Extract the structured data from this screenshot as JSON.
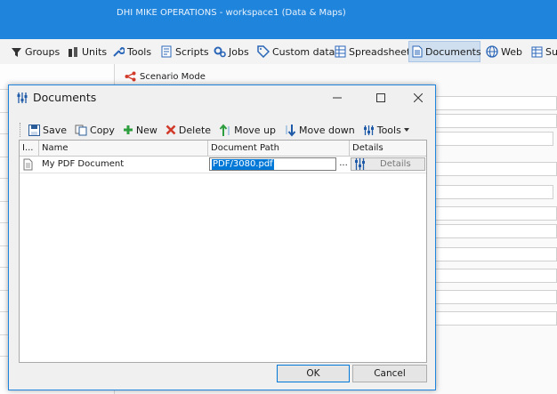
{
  "app": {
    "title": "DHI MIKE OPERATIONS - workspace1 (Data & Maps)"
  },
  "ribbon": {
    "groups": "Groups",
    "units": "Units",
    "tools": "Tools",
    "scripts": "Scripts",
    "jobs": "Jobs",
    "custom_data": "Custom data",
    "spreadsheets": "Spreadsheets",
    "documents": "Documents",
    "web": "Web",
    "sur": "Sur"
  },
  "scenario": {
    "label": "Scenario Mode"
  },
  "dialog": {
    "title": "Documents",
    "toolbar": {
      "save": "Save",
      "copy": "Copy",
      "new": "New",
      "delete": "Delete",
      "move_up": "Move up",
      "move_down": "Move down",
      "tools": "Tools"
    },
    "grid": {
      "columns": {
        "index": "I...",
        "name": "Name",
        "path": "Document Path",
        "details": "Details"
      },
      "rows": [
        {
          "name": "My PDF Document",
          "path": "PDF/3080.pdf",
          "ellipsis": "...",
          "details": "Details"
        }
      ]
    },
    "buttons": {
      "ok": "OK",
      "cancel": "Cancel"
    }
  },
  "colors": {
    "titlebar": "#1f84db",
    "selection": "#0078d7",
    "active_tab": "#cfdff0",
    "new_green": "#2e9e3e",
    "delete_red": "#d23a2a"
  }
}
